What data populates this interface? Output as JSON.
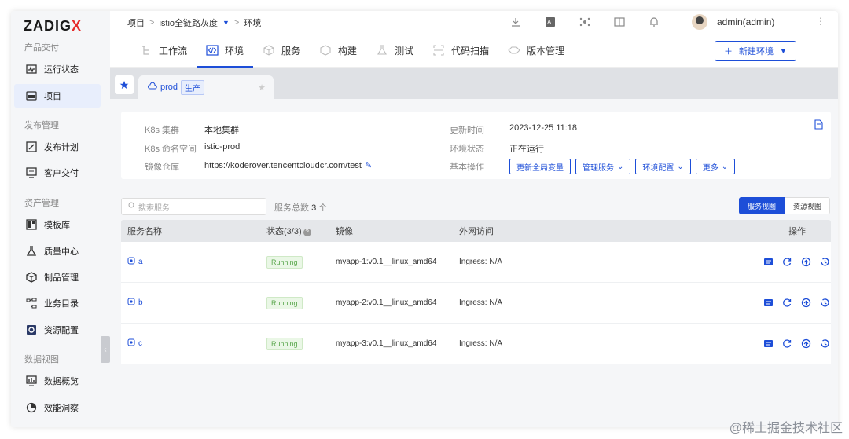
{
  "brand": {
    "logo_main": "ZADIG",
    "logo_x": "X"
  },
  "sidebar": {
    "sections": [
      {
        "title": "产品交付",
        "items": [
          {
            "label": "运行状态",
            "icon": "monitor-pulse-icon"
          },
          {
            "label": "项目",
            "icon": "project-folder-icon",
            "active": true
          }
        ]
      },
      {
        "title": "发布管理",
        "items": [
          {
            "label": "发布计划",
            "icon": "plan-edit-icon"
          },
          {
            "label": "客户交付",
            "icon": "delivery-icon"
          }
        ]
      },
      {
        "title": "资产管理",
        "items": [
          {
            "label": "模板库",
            "icon": "template-icon"
          },
          {
            "label": "质量中心",
            "icon": "flask-icon"
          },
          {
            "label": "制品管理",
            "icon": "package-icon"
          },
          {
            "label": "业务目录",
            "icon": "catalog-icon"
          },
          {
            "label": "资源配置",
            "icon": "gear-box-icon"
          }
        ]
      },
      {
        "title": "数据视图",
        "items": [
          {
            "label": "数据概览",
            "icon": "dashboard-icon"
          },
          {
            "label": "效能洞察",
            "icon": "pie-chart-icon"
          }
        ]
      }
    ]
  },
  "breadcrumb": {
    "item1": "项目",
    "item2": "istio全链路灰度",
    "item3": "环境"
  },
  "user": {
    "name": "admin(admin)"
  },
  "tabs": [
    {
      "label": "工作流",
      "icon": "workflow-icon"
    },
    {
      "label": "环境",
      "icon": "code-icon",
      "active": true
    },
    {
      "label": "服务",
      "icon": "cube-icon"
    },
    {
      "label": "构建",
      "icon": "box-icon"
    },
    {
      "label": "测试",
      "icon": "flask-icon"
    },
    {
      "label": "代码扫描",
      "icon": "scan-icon"
    },
    {
      "label": "版本管理",
      "icon": "version-icon"
    }
  ],
  "new_env_button": "新建环境",
  "env_tab": {
    "name": "prod",
    "tag": "生产"
  },
  "env_info": {
    "k8s_cluster_label": "K8s 集群",
    "k8s_cluster": "本地集群",
    "namespace_label": "K8s 命名空间",
    "namespace": "istio-prod",
    "registry_label": "镜像仓库",
    "registry": "https://koderover.tencentcloudcr.com/test",
    "updated_label": "更新时间",
    "updated": "2023-12-25 11:18",
    "status_label": "环境状态",
    "status": "正在运行",
    "ops_label": "基本操作"
  },
  "ops": [
    "更新全局变量",
    "管理服务",
    "环境配置",
    "更多"
  ],
  "search": {
    "placeholder": "搜索服务"
  },
  "total": {
    "label": "服务总数",
    "count": "3",
    "unit": "个"
  },
  "views": {
    "service": "服务视图",
    "resource": "资源视图"
  },
  "table": {
    "headers": {
      "name": "服务名称",
      "status": "状态(3/3)",
      "image": "镜像",
      "access": "外网访问",
      "ops": "操作"
    },
    "rows": [
      {
        "name": "a",
        "status": "Running",
        "image": "myapp-1:v0.1__linux_amd64",
        "access": "Ingress: N/A"
      },
      {
        "name": "b",
        "status": "Running",
        "image": "myapp-2:v0.1__linux_amd64",
        "access": "Ingress: N/A"
      },
      {
        "name": "c",
        "status": "Running",
        "image": "myapp-3:v0.1__linux_amd64",
        "access": "Ingress: N/A"
      }
    ]
  },
  "watermark": "@稀土掘金技术社区",
  "colors": {
    "accent": "#1d4ed8",
    "running_bg": "#eaf7e6",
    "running_fg": "#5aa74d",
    "logo_x": "#e62b2b"
  }
}
